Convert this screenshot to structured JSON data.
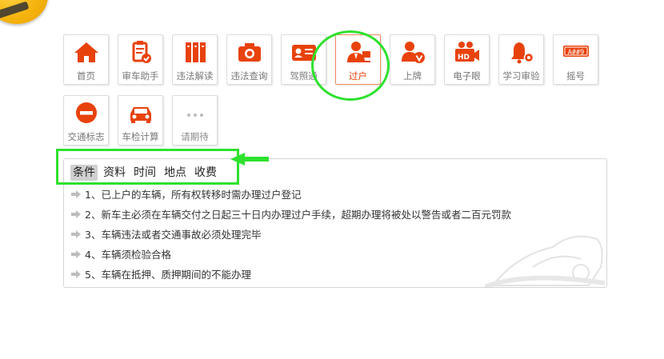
{
  "colors": {
    "accent": "#e8420c",
    "highlight": "#2ee12e"
  },
  "nav": {
    "row1": [
      {
        "label": "首页",
        "icon": "home-icon"
      },
      {
        "label": "审车助手",
        "icon": "clipboard-check-icon"
      },
      {
        "label": "违法解读",
        "icon": "books-icon"
      },
      {
        "label": "违法查询",
        "icon": "camera-icon"
      },
      {
        "label": "驾照通",
        "icon": "id-card-icon"
      },
      {
        "label": "过户",
        "icon": "person-transfer-icon",
        "active": true
      },
      {
        "label": "上牌",
        "icon": "person-badge-icon"
      },
      {
        "label": "电子眼",
        "icon": "hd-camera-icon"
      },
      {
        "label": "学习审验",
        "icon": "bell-gear-icon"
      },
      {
        "label": "摇号",
        "icon": "plate-icon",
        "plate_text": "A##9"
      }
    ],
    "row2": [
      {
        "label": "交通标志",
        "icon": "no-entry-icon"
      },
      {
        "label": "车检计算",
        "icon": "car-icon"
      },
      {
        "label": "请期待",
        "icon": "ellipsis-icon"
      }
    ]
  },
  "panel": {
    "tabs": [
      "条件",
      "资料",
      "时间",
      "地点",
      "收费"
    ],
    "active_tab": "条件",
    "items": [
      "1、已上户的车辆，所有权转移时需办理过户登记",
      "2、新车主必须在车辆交付之日起三十日内办理过户手续，超期办理将被处以警告或者二百元罚款",
      "3、车辆违法或者交通事故必须处理完毕",
      "4、车辆须检验合格",
      "5、车辆在抵押、质押期间的不能办理"
    ]
  }
}
